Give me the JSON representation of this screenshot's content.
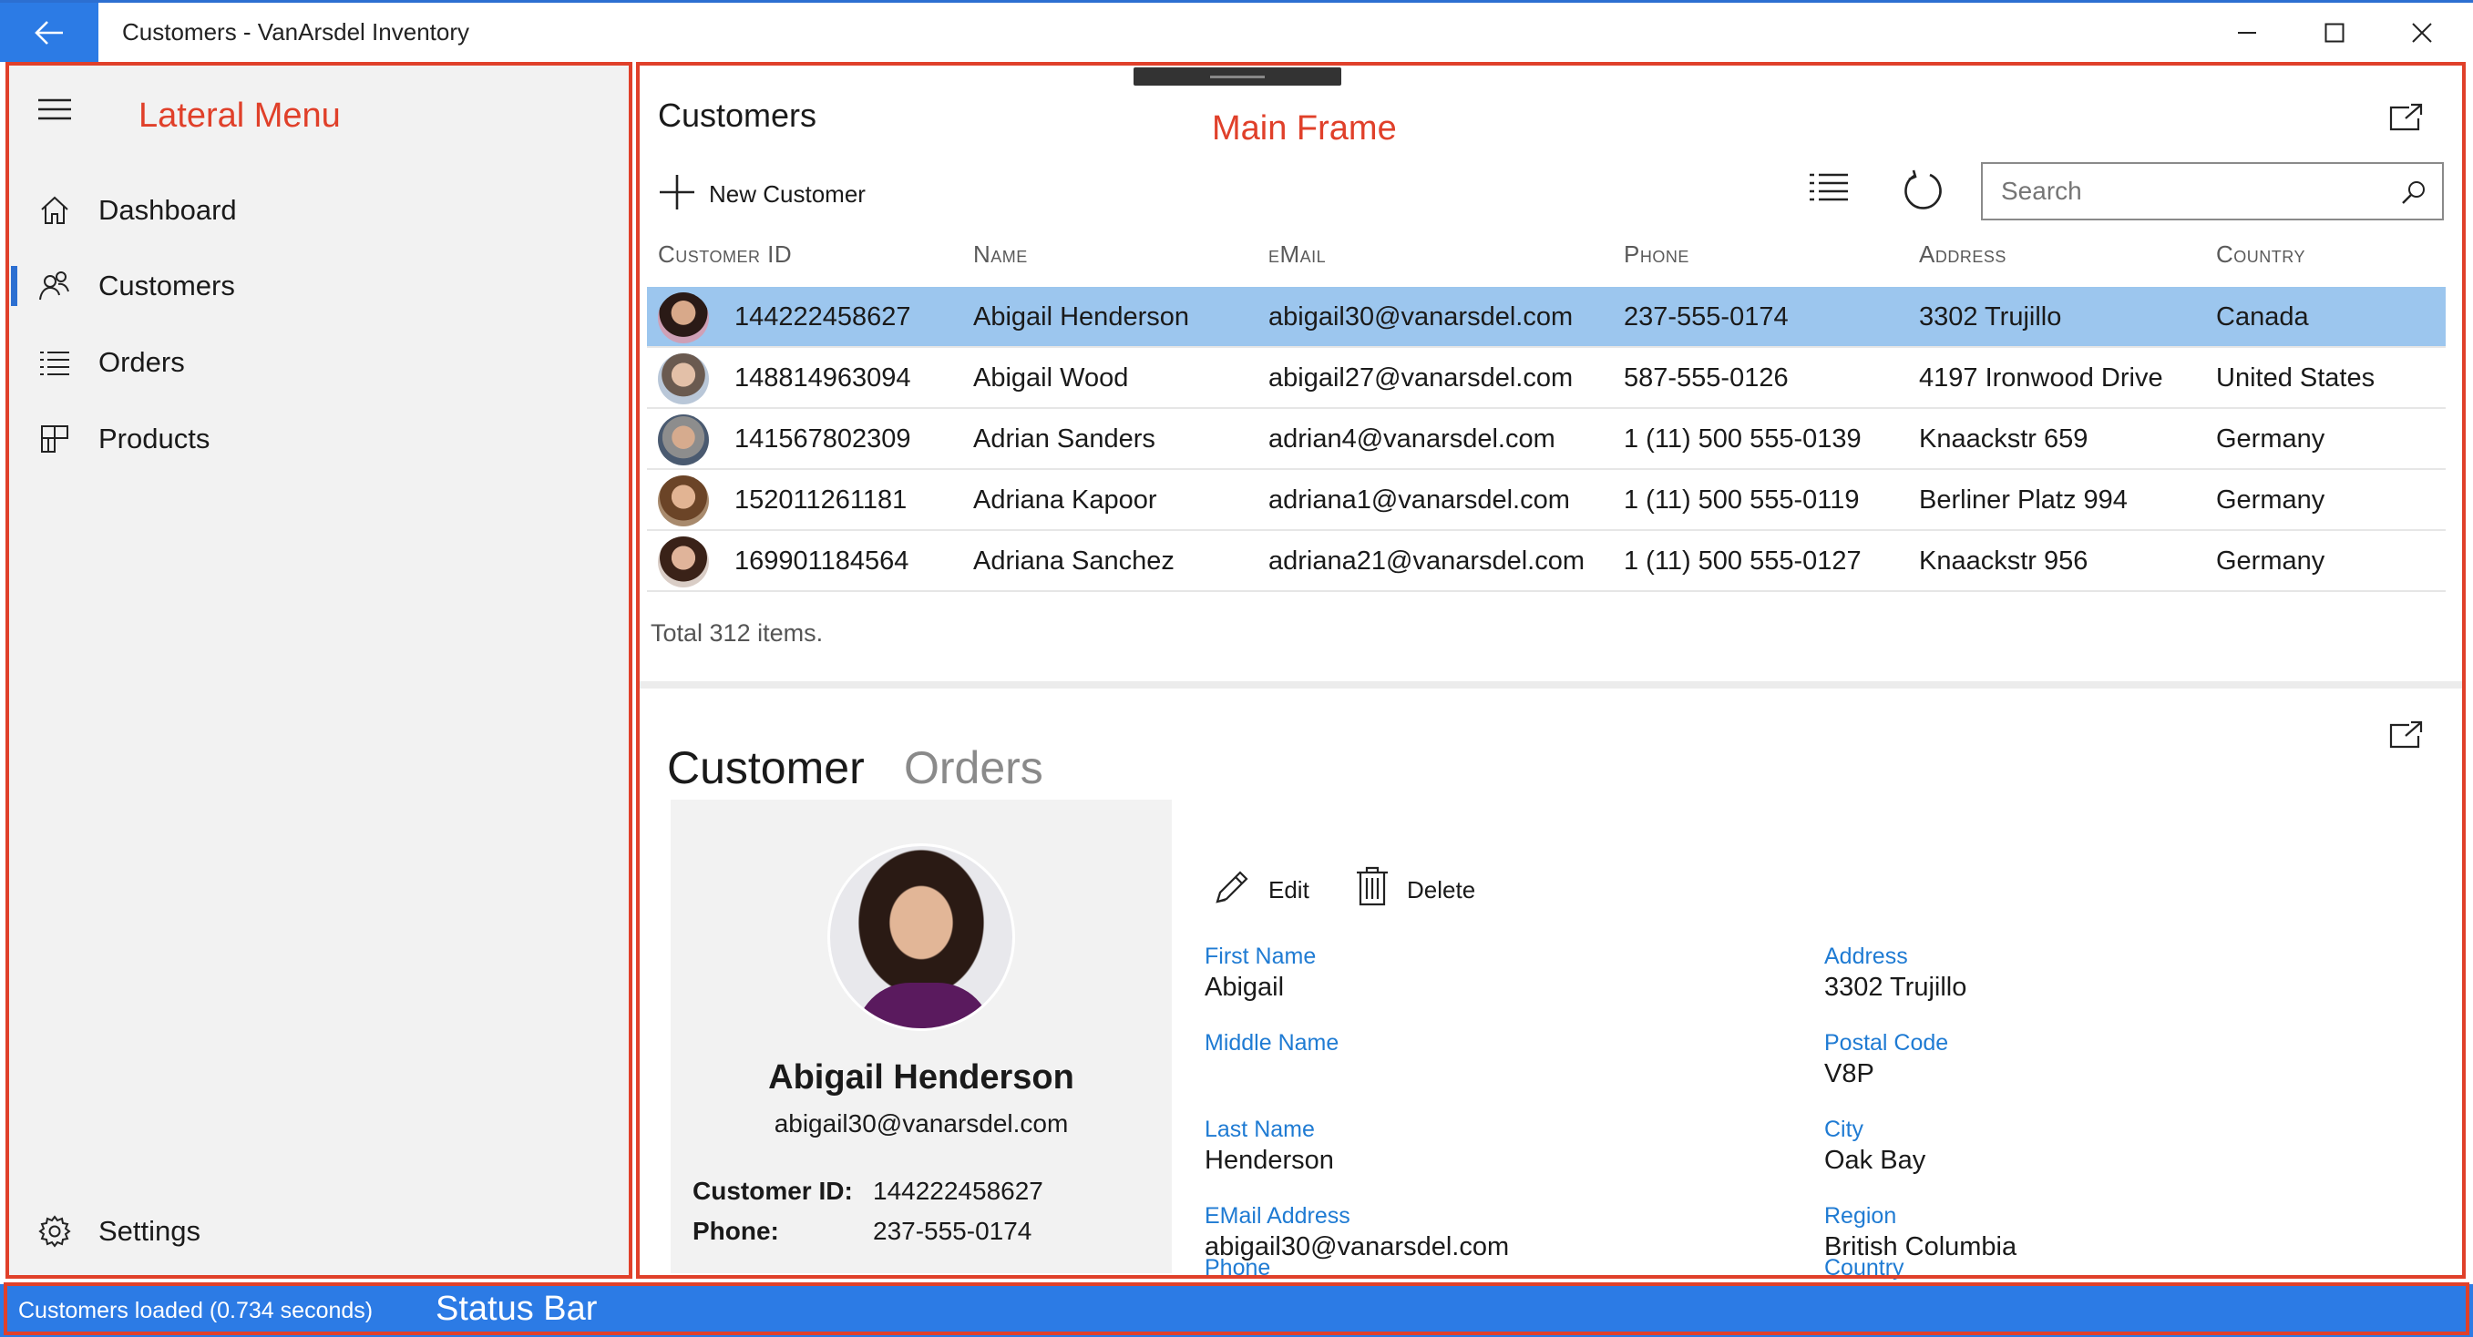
{
  "window": {
    "title": "Customers - VanArsdel Inventory",
    "accent": "#2c7be5"
  },
  "annotations": {
    "lateral_menu": "Lateral Menu",
    "main_frame": "Main Frame",
    "status_bar": "Status Bar",
    "color": "#e0402a"
  },
  "nav": {
    "items": [
      {
        "label": "Dashboard",
        "icon": "home-icon"
      },
      {
        "label": "Customers",
        "icon": "people-icon",
        "selected": true
      },
      {
        "label": "Orders",
        "icon": "list-icon"
      },
      {
        "label": "Products",
        "icon": "products-icon"
      }
    ],
    "settings_label": "Settings"
  },
  "list": {
    "title": "Customers",
    "new_button": "New Customer",
    "search_placeholder": "Search",
    "columns": [
      "Customer ID",
      "Name",
      "eMail",
      "Phone",
      "Address",
      "Country"
    ],
    "rows": [
      {
        "id": "144222458627",
        "name": "Abigail Henderson",
        "email": "abigail30@vanarsdel.com",
        "phone": "237-555-0174",
        "address": "3302 Trujillo",
        "country": "Canada",
        "selected": true
      },
      {
        "id": "148814963094",
        "name": "Abigail Wood",
        "email": "abigail27@vanarsdel.com",
        "phone": "587-555-0126",
        "address": "4197 Ironwood Drive",
        "country": "United States"
      },
      {
        "id": "141567802309",
        "name": "Adrian Sanders",
        "email": "adrian4@vanarsdel.com",
        "phone": "1 (11) 500 555-0139",
        "address": "Knaackstr 659",
        "country": "Germany"
      },
      {
        "id": "152011261181",
        "name": "Adriana Kapoor",
        "email": "adriana1@vanarsdel.com",
        "phone": "1 (11) 500 555-0119",
        "address": "Berliner Platz 994",
        "country": "Germany"
      },
      {
        "id": "169901184564",
        "name": "Adriana Sanchez",
        "email": "adriana21@vanarsdel.com",
        "phone": "1 (11) 500 555-0127",
        "address": "Knaackstr 956",
        "country": "Germany"
      }
    ],
    "total": "Total 312 items."
  },
  "detail": {
    "tab_customer": "Customer",
    "tab_orders": "Orders",
    "edit_label": "Edit",
    "delete_label": "Delete",
    "card": {
      "name": "Abigail Henderson",
      "email": "abigail30@vanarsdel.com",
      "id_label": "Customer ID:",
      "id_value": "144222458627",
      "phone_label": "Phone:",
      "phone_value": "237-555-0174"
    },
    "fields": {
      "first_name_label": "First Name",
      "first_name": "Abigail",
      "middle_name_label": "Middle Name",
      "middle_name": "",
      "last_name_label": "Last Name",
      "last_name": "Henderson",
      "email_label": "EMail Address",
      "email": "abigail30@vanarsdel.com",
      "phone_label": "Phone",
      "address_label": "Address",
      "address": "3302 Trujillo",
      "postal_label": "Postal Code",
      "postal": "V8P",
      "city_label": "City",
      "city": "Oak Bay",
      "region_label": "Region",
      "region": "British Columbia",
      "country_label": "Country"
    }
  },
  "status": {
    "text": "Customers loaded (0.734 seconds)"
  }
}
